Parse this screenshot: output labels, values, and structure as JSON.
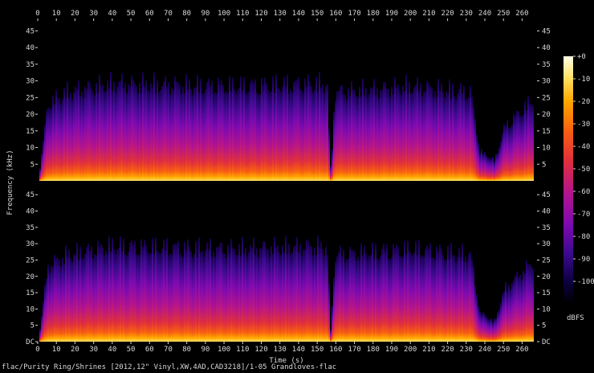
{
  "footer": "flac/Purity Ring/Shrines [2012,12\" Vinyl,XW,4AD,CAD3218]/1-05 Grandloves-flac",
  "chart_data": {
    "type": "heatmap",
    "kind": "spectrogram",
    "xlabel": "Time (s)",
    "ylabel": "Frequency (kHz)",
    "xlim": [
      0,
      268
    ],
    "ylim": [
      0,
      48
    ],
    "x_ticks": [
      0,
      10,
      20,
      30,
      40,
      50,
      60,
      70,
      80,
      90,
      100,
      110,
      120,
      130,
      140,
      150,
      160,
      170,
      180,
      190,
      200,
      210,
      220,
      230,
      240,
      250,
      260
    ],
    "y_ticks": [
      "DC",
      "5",
      "10",
      "15",
      "20",
      "25",
      "30",
      "35",
      "40",
      "45"
    ],
    "y_tick_values": [
      0,
      5,
      10,
      15,
      20,
      25,
      30,
      35,
      40,
      45
    ],
    "channels": 2,
    "colorbar": {
      "label": "dBFS",
      "ticks": [
        "+0",
        "-10",
        "-20",
        "-30",
        "-40",
        "-50",
        "-60",
        "-70",
        "-80",
        "-90",
        "-100"
      ],
      "tick_values": [
        0,
        -10,
        -20,
        -30,
        -40,
        -50,
        -60,
        -70,
        -80,
        -90,
        -100
      ],
      "range": [
        -110,
        0
      ],
      "colors": [
        "#000000",
        "#0d0040",
        "#3a0a8c",
        "#7d0ab0",
        "#b4148c",
        "#e0303c",
        "#f86010",
        "#ffa800",
        "#ffe060",
        "#ffffe8"
      ]
    },
    "content_upper_khz": [
      {
        "t": 0,
        "khz": 0
      },
      {
        "t": 5,
        "khz": 26
      },
      {
        "t": 15,
        "khz": 30
      },
      {
        "t": 40,
        "khz": 33
      },
      {
        "t": 100,
        "khz": 32
      },
      {
        "t": 155,
        "khz": 33
      },
      {
        "t": 157,
        "khz": 2
      },
      {
        "t": 159,
        "khz": 30
      },
      {
        "t": 200,
        "khz": 32
      },
      {
        "t": 232,
        "khz": 30
      },
      {
        "t": 237,
        "khz": 10
      },
      {
        "t": 245,
        "khz": 7
      },
      {
        "t": 250,
        "khz": 18
      },
      {
        "t": 266,
        "khz": 28
      }
    ]
  }
}
